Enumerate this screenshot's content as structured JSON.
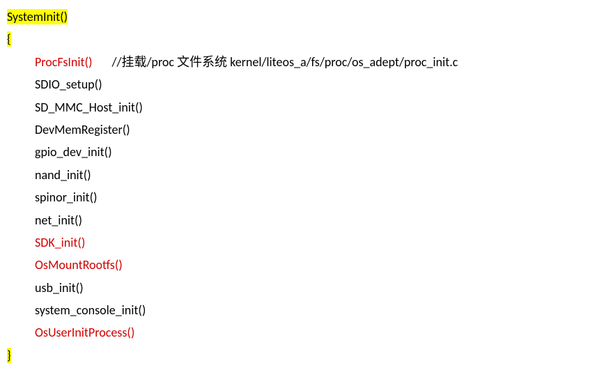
{
  "header": {
    "func_name": "SystemInit()",
    "open_brace": "{",
    "close_brace": "}"
  },
  "lines": {
    "l1_call": "ProcFsInit()",
    "l1_comment": "//挂载/proc 文件系统  kernel/liteos_a/fs/proc/os_adept/proc_init.c",
    "l2": "SDIO_setup()",
    "l3": "SD_MMC_Host_init()",
    "l4": "DevMemRegister()",
    "l5": "gpio_dev_init()",
    "l6": "nand_init()",
    "l7": "spinor_init()",
    "l8": "net_init()",
    "l9": "SDK_init()",
    "l10": "OsMountRootfs()",
    "l11": "usb_init()",
    "l12": "system_console_init()",
    "l13": "OsUserInitProcess()"
  }
}
